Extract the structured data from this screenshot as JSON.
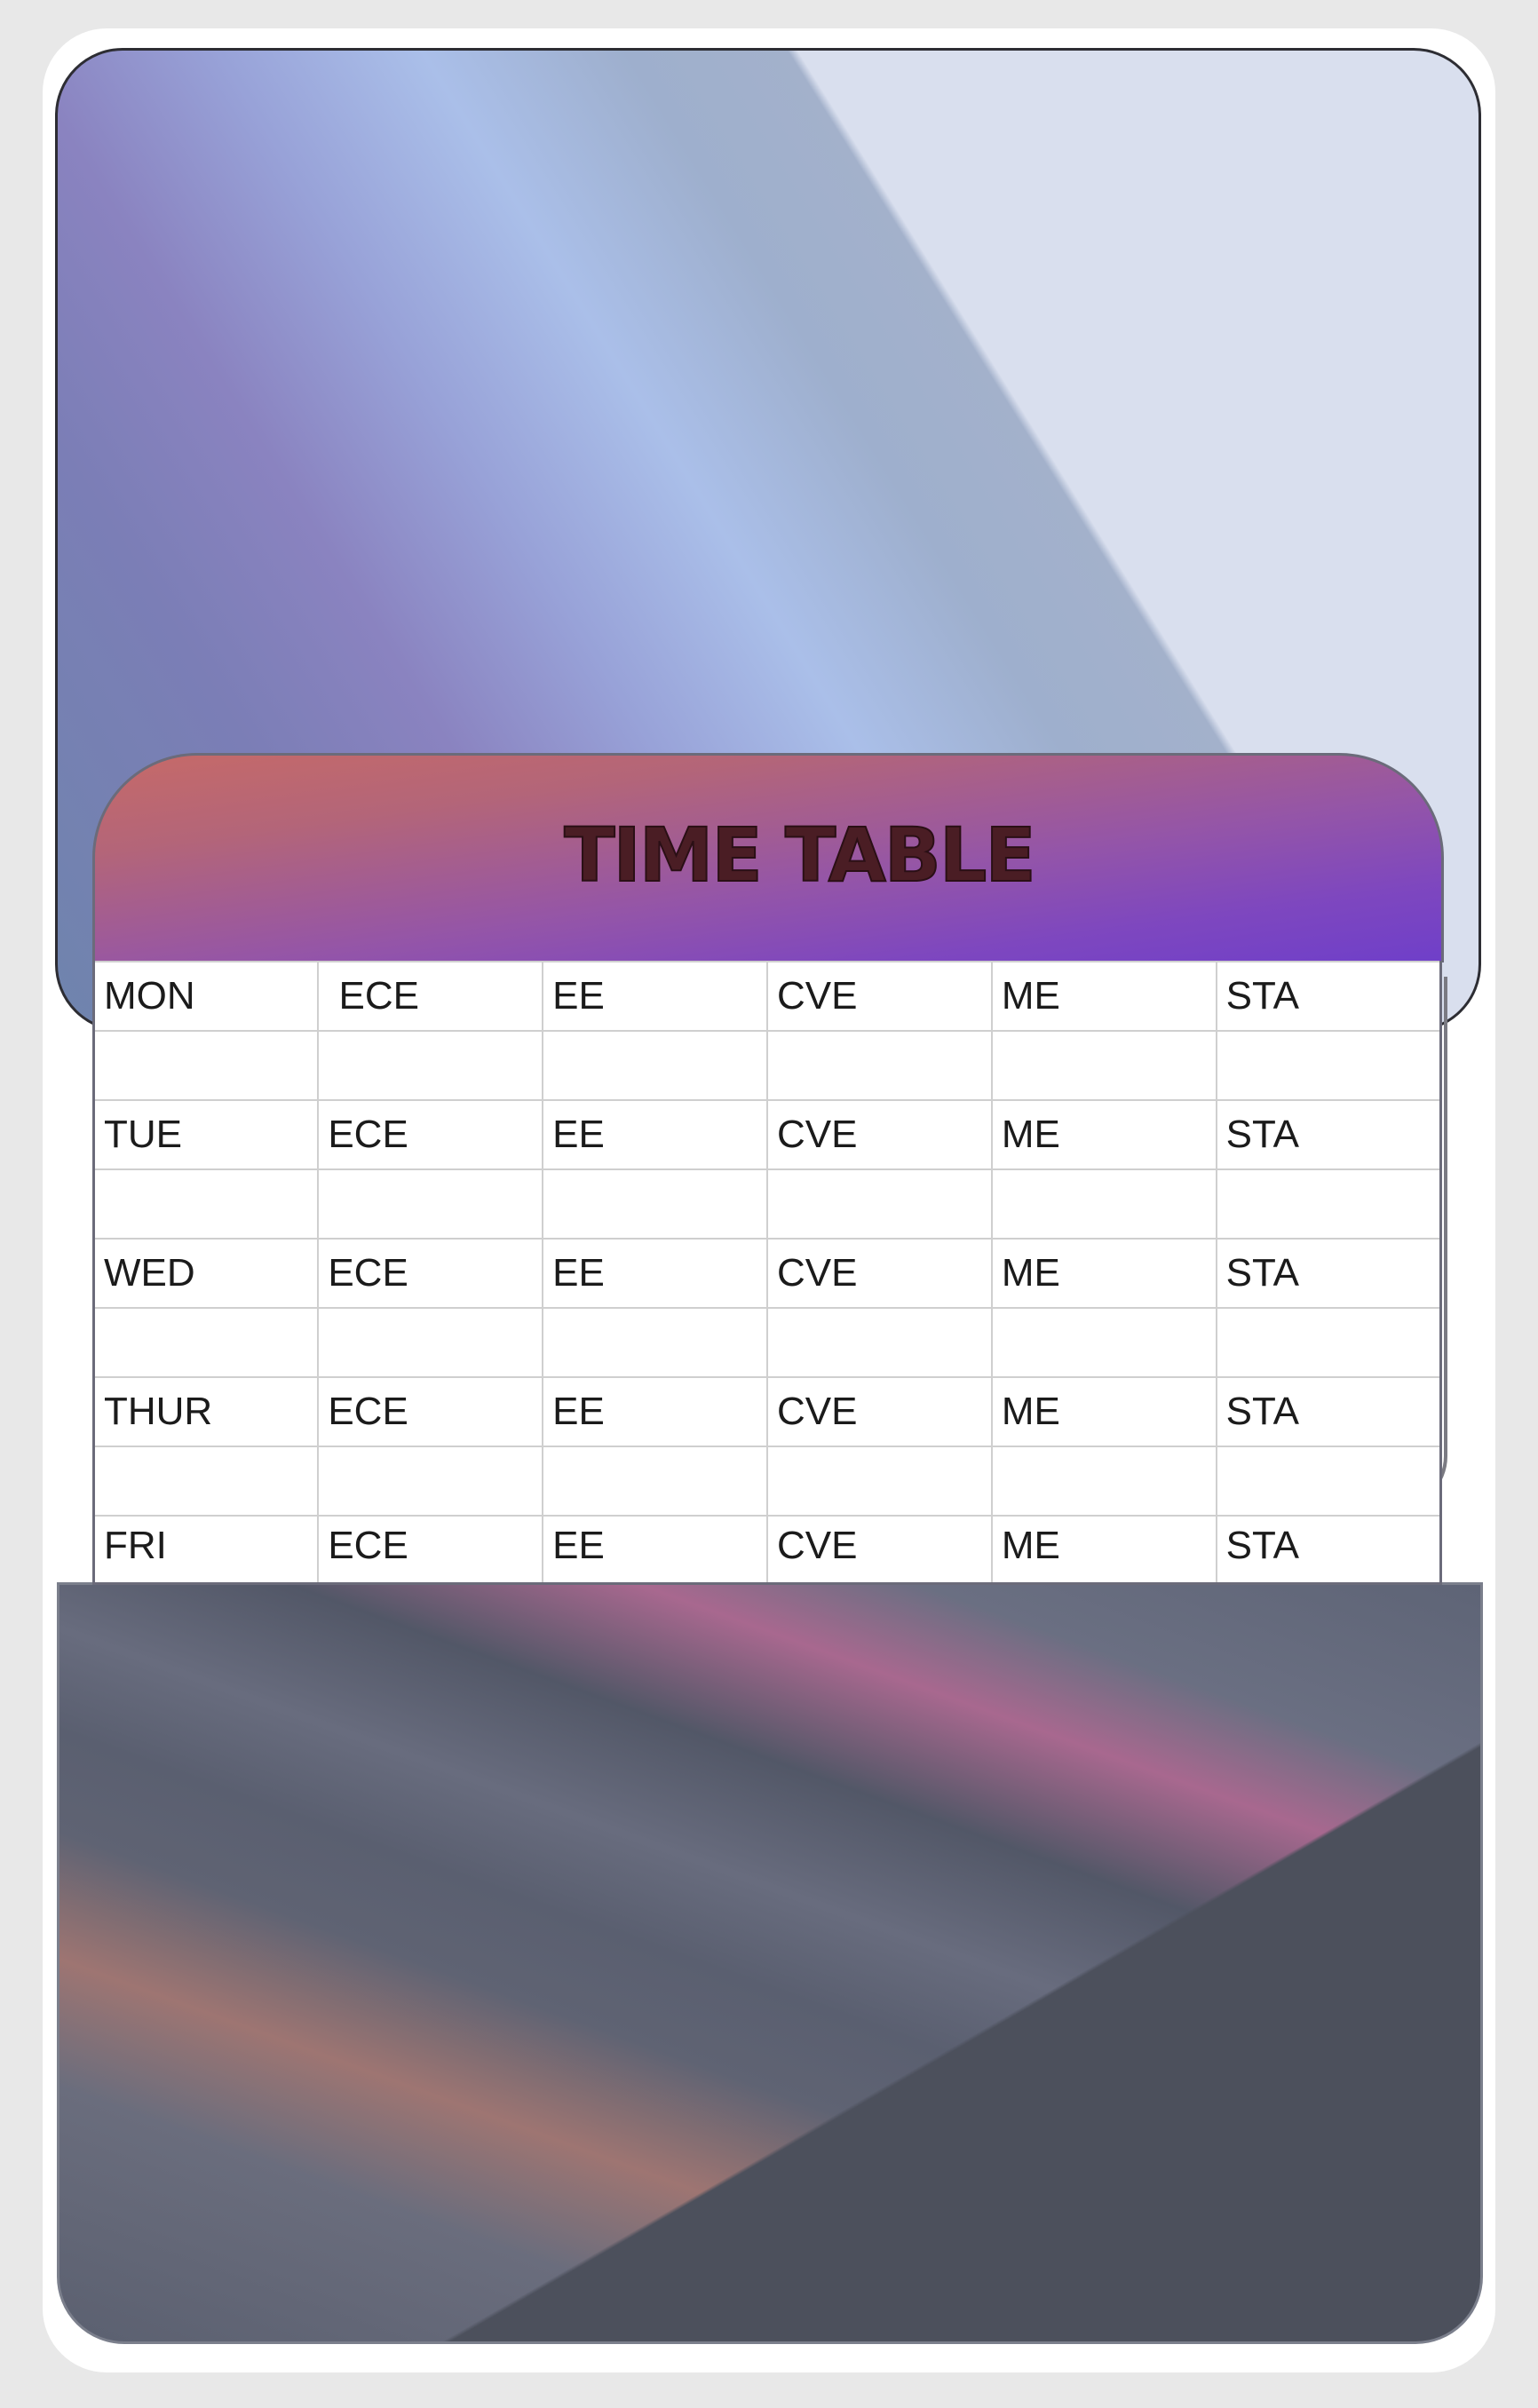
{
  "title": "TIME TABLE",
  "rows": [
    {
      "day": "MON",
      "cells": [
        " ECE",
        "EE",
        "CVE",
        "ME",
        "STA"
      ]
    },
    {
      "day": "",
      "cells": [
        "",
        "",
        "",
        "",
        ""
      ]
    },
    {
      "day": "TUE",
      "cells": [
        "ECE",
        "EE",
        "CVE",
        "ME",
        "STA"
      ]
    },
    {
      "day": "",
      "cells": [
        "",
        "",
        "",
        "",
        ""
      ]
    },
    {
      "day": "WED",
      "cells": [
        "ECE",
        "EE",
        "CVE",
        "ME",
        "STA"
      ]
    },
    {
      "day": "",
      "cells": [
        "",
        "",
        "",
        "",
        ""
      ]
    },
    {
      "day": "THUR",
      "cells": [
        "ECE",
        "EE",
        "CVE",
        "ME",
        "STA"
      ]
    },
    {
      "day": "",
      "cells": [
        "",
        "",
        "",
        "",
        ""
      ]
    },
    {
      "day": "FRI",
      "cells": [
        "ECE",
        "EE",
        "CVE",
        "ME",
        "STA"
      ]
    }
  ]
}
